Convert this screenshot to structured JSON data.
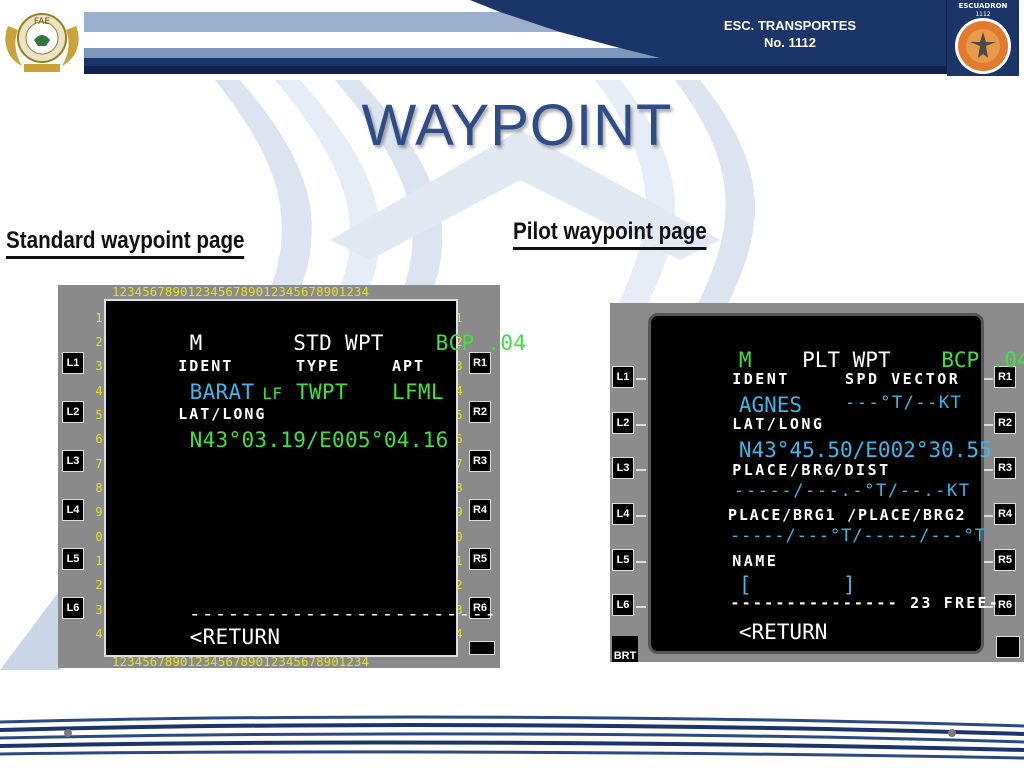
{
  "header": {
    "title_line1": "ESC. TRANSPORTES",
    "title_line2": "No. 1112",
    "left_logo_text": "FAE",
    "right_logo_text": "ESCUADRON 1112",
    "colors": {
      "navy": "#1c3568",
      "stripe_light": "#9ab0cc"
    }
  },
  "page_title": "WAYPOINT",
  "sections": {
    "standard_heading": "Standard waypoint page",
    "pilot_heading": "Pilot waypoint page"
  },
  "std": {
    "col_numbers": "1234567890123456789012345678901234",
    "row_numbers": [
      "1",
      "2",
      "3",
      "4",
      "5",
      "6",
      "7",
      "8",
      "9",
      "0",
      "1",
      "2",
      "3",
      "4"
    ],
    "keys_left": [
      "L1",
      "L2",
      "L3",
      "L4",
      "L5",
      "L6"
    ],
    "keys_right": [
      "R1",
      "R2",
      "R3",
      "R4",
      "R5",
      "R6"
    ],
    "title_mode": "M",
    "title": "STD WPT",
    "title_right": "BCP .04",
    "ident_label": "IDENT",
    "type_label": "TYPE",
    "apt_label": "APT",
    "ident_value": "BARAT",
    "ident_suffix": "LF",
    "type_value": "TWPT",
    "apt_value": "LFML",
    "latlong_label": "LAT/LONG",
    "latlong_value": "N43°03.19/E005°04.16",
    "separator": "------------------------",
    "return_label": "<RETURN"
  },
  "plt": {
    "keys_left": [
      "L1",
      "L2",
      "L3",
      "L4",
      "L5",
      "L6"
    ],
    "keys_right": [
      "R1",
      "R2",
      "R3",
      "R4",
      "R5",
      "R6"
    ],
    "brt_label": "BRT",
    "title_mode": "M",
    "title": "PLT WPT",
    "title_right": "BCP .04",
    "ident_label": "IDENT",
    "spd_vector_label": "SPD VECTOR",
    "ident_value": "AGNES",
    "spd_vector_value": "---°T/--KT",
    "latlong_label": "LAT/LONG",
    "latlong_value": "N43°45.50/E002°30.55",
    "place_brg_label": "PLACE/BRG",
    "dist_label": "/DIST",
    "place_brg_value": "-----/---.-°T/--.-KT",
    "place_brg12_label": "PLACE/BRG1 /PLACE/BRG2",
    "place_brg12_value": "-----/---°T/-----/---°T",
    "name_label": "NAME",
    "name_open": "[",
    "name_close": "]",
    "free_line": "--------------- 23 FREE-",
    "return_label": "<RETURN"
  }
}
